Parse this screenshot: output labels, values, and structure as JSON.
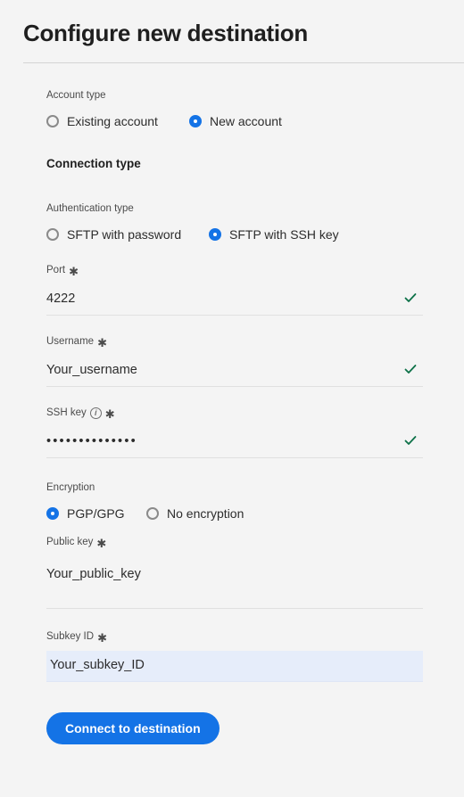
{
  "header": {
    "title": "Configure new destination"
  },
  "form": {
    "account_type": {
      "label": "Account type",
      "options": [
        {
          "label": "Existing account",
          "selected": false
        },
        {
          "label": "New account",
          "selected": true
        }
      ]
    },
    "connection_type_heading": "Connection type",
    "authentication_type": {
      "label": "Authentication type",
      "options": [
        {
          "label": "SFTP with password",
          "selected": false
        },
        {
          "label": "SFTP with SSH key",
          "selected": true
        }
      ]
    },
    "port": {
      "label": "Port",
      "required": "✱",
      "value": "4222",
      "valid": true
    },
    "username": {
      "label": "Username",
      "required": "✱",
      "value": "Your_username",
      "valid": true
    },
    "ssh_key": {
      "label": "SSH key",
      "info_icon": "info-icon",
      "required": "✱",
      "value": "••••••••••••••",
      "valid": true
    },
    "encryption": {
      "label": "Encryption",
      "options": [
        {
          "label": "PGP/GPG",
          "selected": true
        },
        {
          "label": "No encryption",
          "selected": false
        }
      ]
    },
    "public_key": {
      "label": "Public key",
      "required": "✱",
      "value": "Your_public_key"
    },
    "subkey_id": {
      "label": "Subkey ID",
      "required": "✱",
      "value": "Your_subkey_ID"
    },
    "submit_button": "Connect to destination"
  },
  "colors": {
    "accent": "#1473e6",
    "valid": "#0d7148",
    "background": "#f4f4f4",
    "highlight": "#e6edfa",
    "divider": "#e0e0e0"
  }
}
